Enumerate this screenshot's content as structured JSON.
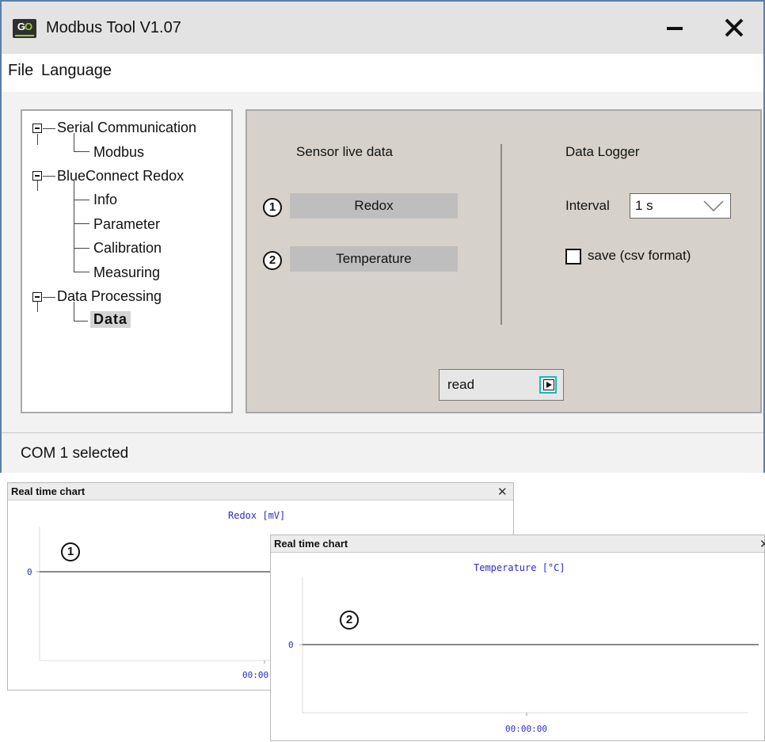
{
  "window": {
    "title": "Modbus Tool V1.07",
    "logo_text_g": "G",
    "logo_text_o": "O"
  },
  "menu": {
    "items": [
      "File",
      "Language"
    ]
  },
  "tree": {
    "items": [
      {
        "label": "Serial Communication",
        "level": 0,
        "expanded": true
      },
      {
        "label": "Modbus",
        "level": 1
      },
      {
        "label": "BlueConnect Redox",
        "level": 0,
        "expanded": true
      },
      {
        "label": "Info",
        "level": 1
      },
      {
        "label": "Parameter",
        "level": 1
      },
      {
        "label": "Calibration",
        "level": 1
      },
      {
        "label": "Measuring",
        "level": 1
      },
      {
        "label": "Data Processing",
        "level": 0,
        "expanded": true
      },
      {
        "label": "Data",
        "level": 1,
        "selected": true
      }
    ]
  },
  "live": {
    "heading": "Sensor live data",
    "rows": [
      {
        "badge": "1",
        "label": "Redox"
      },
      {
        "badge": "2",
        "label": "Temperature"
      }
    ]
  },
  "logger": {
    "heading": "Data Logger",
    "interval_label": "Interval",
    "interval_value": "1 s",
    "save_label": "save (csv format)",
    "save_checked": false
  },
  "read_button": {
    "label": "read"
  },
  "status": {
    "text": "COM 1 selected"
  },
  "charts": [
    {
      "window_title": "Real time chart",
      "title": "Redox [mV]",
      "badge": "1",
      "y_tick": "0",
      "x_tick": "00:00"
    },
    {
      "window_title": "Real time chart",
      "title": "Temperature [°C]",
      "badge": "2",
      "y_tick": "0",
      "x_tick": "00:00:00"
    }
  ],
  "chart_data": [
    {
      "type": "line",
      "title": "Redox [mV]",
      "series": [
        {
          "values": [
            0,
            0
          ]
        }
      ],
      "y_ticks": [
        "0"
      ],
      "x_ticks": [
        "00:00"
      ]
    },
    {
      "type": "line",
      "title": "Temperature [°C]",
      "series": [
        {
          "values": [
            0,
            0
          ]
        }
      ],
      "y_ticks": [
        "0"
      ],
      "x_ticks": [
        "00:00:00"
      ]
    }
  ],
  "colors": {
    "titlebar": "#e3e3e3",
    "panel": "#d6d2cb",
    "value_box": "#bebebe",
    "chart_text": "#2b2bd0",
    "accent": "#14b8c8",
    "window_border": "#5b7ea6"
  }
}
